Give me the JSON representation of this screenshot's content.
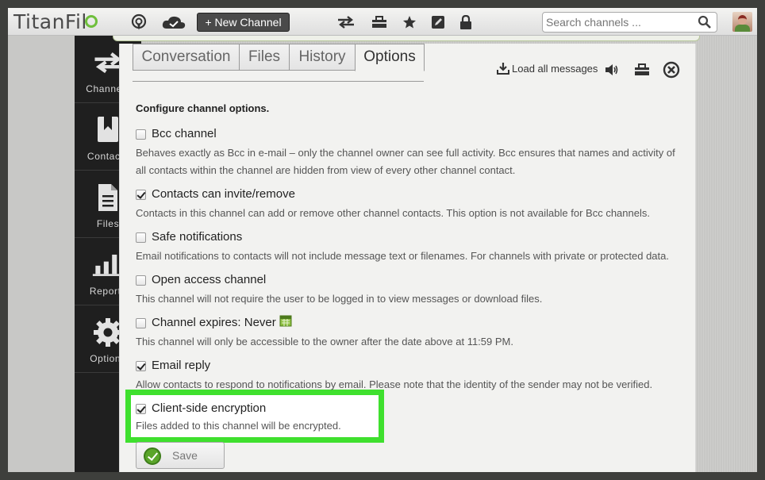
{
  "app": {
    "logo": "TitanFil"
  },
  "header": {
    "new_channel_label": "+ New Channel",
    "search_placeholder": "Search channels ..."
  },
  "sidebar": {
    "items": [
      {
        "label": "Channels",
        "icon": "arrows-icon"
      },
      {
        "label": "Contacts",
        "icon": "bookmark-book-icon"
      },
      {
        "label": "Files",
        "icon": "document-icon"
      },
      {
        "label": "Reports",
        "icon": "bar-chart-icon"
      },
      {
        "label": "Options",
        "icon": "gear-icon"
      }
    ]
  },
  "tabs": [
    {
      "label": "Conversation",
      "active": false
    },
    {
      "label": "Files",
      "active": false
    },
    {
      "label": "History",
      "active": false
    },
    {
      "label": "Options",
      "active": true
    }
  ],
  "toolbar": {
    "load_all": "Load all messages"
  },
  "options": {
    "heading": "Configure channel options.",
    "items": [
      {
        "title": "Bcc channel",
        "checked": false,
        "desc": "Behaves exactly as Bcc in e-mail – only the channel owner can see full activity. Bcc ensures that names and activity of all contacts within the channel are hidden from view of every other channel contact."
      },
      {
        "title": "Contacts can invite/remove",
        "checked": true,
        "desc": "Contacts in this channel can add or remove other channel contacts. This option is not available for Bcc channels."
      },
      {
        "title": "Safe notifications",
        "checked": false,
        "desc": "Email notifications to contacts will not include message text or filenames. For channels with private or protected data."
      },
      {
        "title": "Open access channel",
        "checked": false,
        "desc": "This channel will not require the user to be logged in to view messages or download files."
      },
      {
        "title": "Channel expires: Never",
        "checked": false,
        "desc": "This channel will only be accessible to the owner after the date above at 11:59 PM."
      },
      {
        "title": "Email reply",
        "checked": true,
        "desc": "Allow contacts to respond to notifications by email. Please note that the identity of the sender may not be verified."
      },
      {
        "title": "Client-side encryption",
        "checked": true,
        "desc": "Files added to this channel will be encrypted."
      }
    ],
    "save_label": "Save"
  },
  "colors": {
    "highlight": "#3fe02e",
    "sidebar": "#1f1f1f",
    "save_ok": "#5aa52a"
  }
}
